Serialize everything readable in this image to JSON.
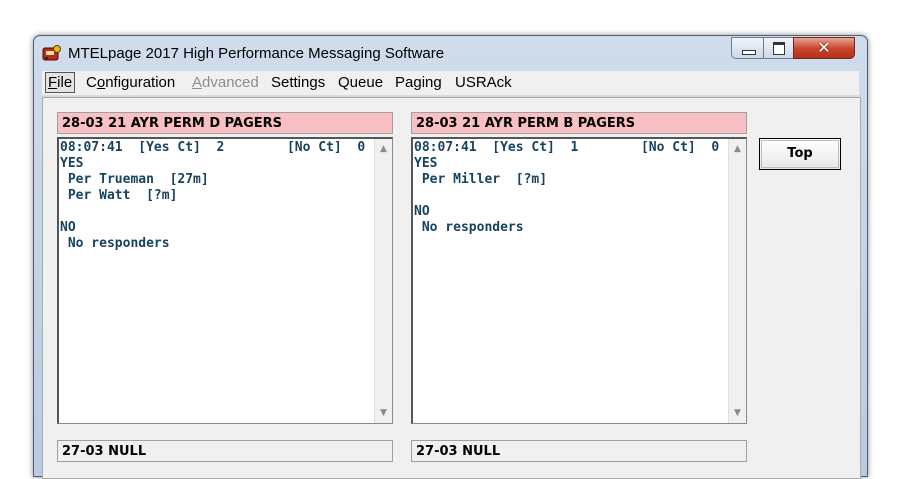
{
  "window": {
    "title": "MTELpage 2017   High Performance Messaging Software",
    "close_symbol": "✕"
  },
  "menu": {
    "items": [
      {
        "label": "File",
        "disabled": false
      },
      {
        "label": "Configuration",
        "disabled": false
      },
      {
        "label": "Advanced",
        "disabled": true
      },
      {
        "label": "Settings",
        "disabled": false
      },
      {
        "label": "Queue",
        "disabled": false
      },
      {
        "label": "Paging",
        "disabled": false
      },
      {
        "label": "USRAck",
        "disabled": false
      }
    ]
  },
  "panels": [
    {
      "header": "28-03  21 AYR PERM D PAGERS",
      "body": "08:07:41  [Yes Ct]  2        [No Ct]  0\nYES\n Per Trueman  [27m]\n Per Watt  [?m]\n\nNO\n No responders"
    },
    {
      "header": "28-03  21 AYR PERM B PAGERS",
      "body": "08:07:41  [Yes Ct]  1        [No Ct]  0\nYES\n Per Miller  [?m]\n\nNO\n No responders"
    },
    {
      "header": "27-03  NULL",
      "body": ""
    },
    {
      "header": "27-03  NULL",
      "body": ""
    }
  ],
  "top_button": {
    "label": "Top"
  },
  "colors": {
    "header_active": "#f9c0c3",
    "text_teal": "#16435f"
  },
  "icons": {
    "app": "pager-app-icon",
    "scroll_up": "▲",
    "scroll_down": "▼"
  }
}
